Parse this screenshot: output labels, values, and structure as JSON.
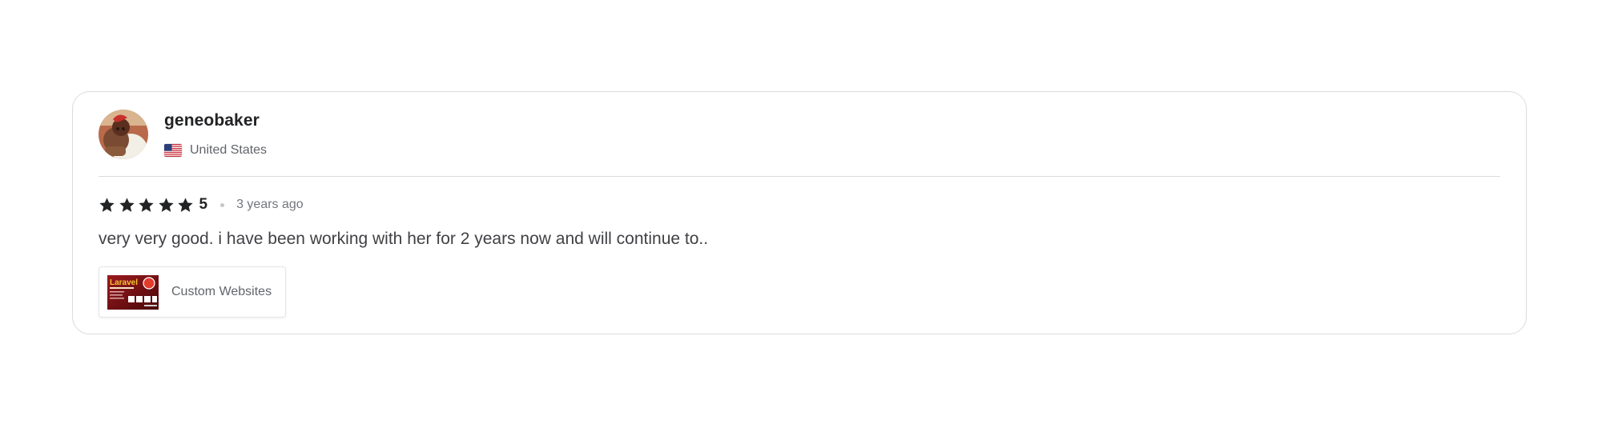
{
  "review": {
    "username": "geneobaker",
    "country": "United States",
    "rating": "5",
    "stars_filled": 5,
    "stars_total": 5,
    "time_ago": "3 years ago",
    "text": "very very good. i have been working with her for 2 years now and will continue to..",
    "gig": {
      "title": "Custom Websites",
      "thumbnail_text": "Laravel"
    },
    "icons": {
      "star": "star-icon",
      "flag": "us-flag-icon"
    }
  },
  "colors": {
    "text_primary": "#222325",
    "text_secondary": "#62646a",
    "text_body": "#404145",
    "border": "#dadbdd",
    "star": "#222325"
  }
}
